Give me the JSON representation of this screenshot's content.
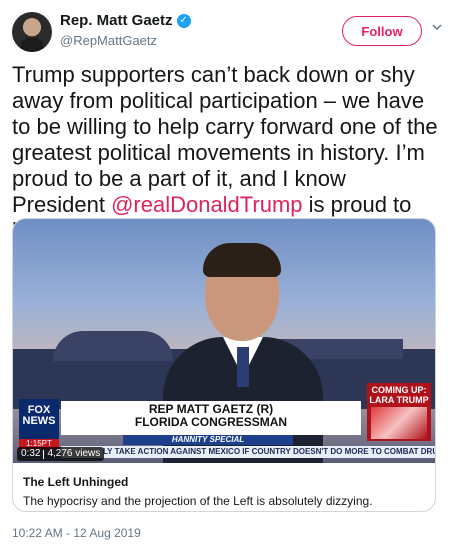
{
  "author": {
    "name": "Rep. Matt Gaetz",
    "handle": "@RepMattGaetz",
    "verified_icon": "verified-badge-icon"
  },
  "actions": {
    "follow_label": "Follow",
    "menu_icon": "chevron-down-icon"
  },
  "tweet": {
    "text_before": "Trump supporters can’t back down or shy away from political participation – we have to be willing to help carry forward one of the greatest political movements in history. I’m proud to be a part of it, and I know President ",
    "mention": "@realDonaldTrump",
    "text_after": " is proud to lead it!",
    "timestamp": "10:22 AM - 12 Aug 2019"
  },
  "video": {
    "duration": "0:32",
    "views": "4,276 views",
    "coming_up": "COMING UP: LARA TRUMP",
    "network_logo": "FOX NEWS",
    "network_sub": "1:15PT",
    "chyron_title": "REP MATT GAETZ (R)",
    "chyron_subtitle": "FLORIDA CONGRESSMAN",
    "show_name": "HANNITY SPECIAL",
    "ticker": "LY TAKE ACTION AGAINST MEXICO IF COUNTRY DOESN'T DO MORE TO COMBAT DRUG"
  },
  "card": {
    "title": "The Left Unhinged",
    "description": "The hypocrisy and the projection of the Left is absolutely dizzying."
  },
  "colors": {
    "accent": "#e0245e",
    "verified": "#1da1f2",
    "muted": "#657786",
    "text": "#14171a"
  }
}
